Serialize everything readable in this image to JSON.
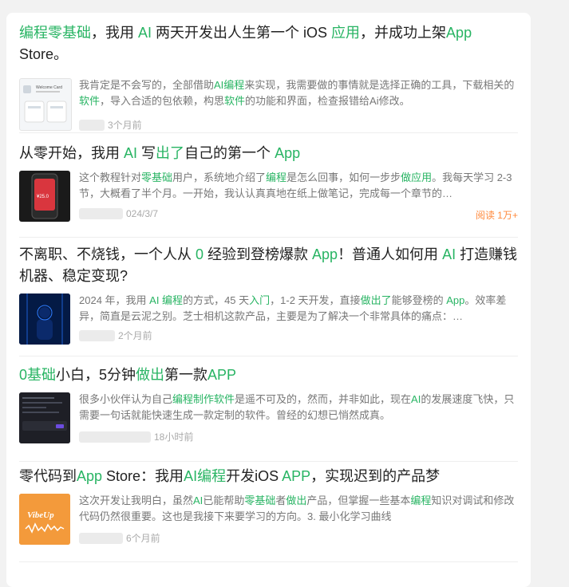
{
  "feed": {
    "items": [
      {
        "title": [
          {
            "t": "编程零基础",
            "hl": true
          },
          {
            "t": "，我用 ",
            "hl": false
          },
          {
            "t": "AI",
            "hl": true
          },
          {
            "t": " 两天开发出人生第一个 iOS ",
            "hl": false
          },
          {
            "t": "应用",
            "hl": true
          },
          {
            "t": "，并成功上架",
            "hl": false
          },
          {
            "t": "App",
            "hl": true
          },
          {
            "t": " Store。",
            "hl": false
          }
        ],
        "summary": [
          {
            "t": "我肯定是不会写的，全部借助",
            "hl": false
          },
          {
            "t": "AI编程",
            "hl": true
          },
          {
            "t": "来实现，我需要做的事情就是选择正确的工具，下载相关的",
            "hl": false
          },
          {
            "t": "软件",
            "hl": true
          },
          {
            "t": "，导入合适的包依赖，构思",
            "hl": false
          },
          {
            "t": "软件",
            "hl": true
          },
          {
            "t": "的功能和界面，检查报错给Ai修改。",
            "hl": false
          }
        ],
        "time": "3个月前",
        "thumb_icon": "app-screenshot-thumbnail",
        "thumb_caption": "Welcome Card"
      },
      {
        "title": [
          {
            "t": "从零开始，我用 ",
            "hl": false
          },
          {
            "t": "AI",
            "hl": true
          },
          {
            "t": " 写",
            "hl": false
          },
          {
            "t": "出了",
            "hl": true
          },
          {
            "t": "自己的第一个 ",
            "hl": false
          },
          {
            "t": "App",
            "hl": true
          }
        ],
        "summary": [
          {
            "t": "这个教程针对",
            "hl": false
          },
          {
            "t": "零基础",
            "hl": true
          },
          {
            "t": "用户，系统地介绍了",
            "hl": false
          },
          {
            "t": "编程",
            "hl": true
          },
          {
            "t": "是怎么回事，如何一步步",
            "hl": false
          },
          {
            "t": "做应用",
            "hl": true
          },
          {
            "t": "。我每天学习 2-3 节，大概看了半个月。一开始，我认认真真地在纸上做笔记，完成每一个章节的…",
            "hl": false
          }
        ],
        "time": "024/3/7",
        "reads": "阅读 1万+",
        "thumb_icon": "phone-thumbnail",
        "thumb_caption": "¥25.0"
      },
      {
        "title": [
          {
            "t": "不离职、不烧钱，一个人从 ",
            "hl": false
          },
          {
            "t": "0",
            "hl": true
          },
          {
            "t": " 经验到登榜爆款 ",
            "hl": false
          },
          {
            "t": "App",
            "hl": true
          },
          {
            "t": "！普通人如何用 ",
            "hl": false
          },
          {
            "t": "AI",
            "hl": true
          },
          {
            "t": " 打造赚钱机器、稳定变现?",
            "hl": false
          }
        ],
        "summary": [
          {
            "t": "2024 年，我用 ",
            "hl": false
          },
          {
            "t": "AI 编程",
            "hl": true
          },
          {
            "t": "的方式，45 天",
            "hl": false
          },
          {
            "t": "入门",
            "hl": true
          },
          {
            "t": "，1-2 天开发，直接",
            "hl": false
          },
          {
            "t": "做出了",
            "hl": true
          },
          {
            "t": "能够登榜的 ",
            "hl": false
          },
          {
            "t": "App",
            "hl": true
          },
          {
            "t": "。效率差异，简直是云泥之别。芝士相机这款产品，主要是为了解决一个非常具体的痛点：…",
            "hl": false
          }
        ],
        "time": "2个月前",
        "thumb_icon": "digital-figure-thumbnail"
      },
      {
        "title": [
          {
            "t": "0基础",
            "hl": true
          },
          {
            "t": "小白，5分钟",
            "hl": false
          },
          {
            "t": "做出",
            "hl": true
          },
          {
            "t": "第一款",
            "hl": false
          },
          {
            "t": "APP",
            "hl": true
          }
        ],
        "summary": [
          {
            "t": "很多小伙伴认为自己",
            "hl": false
          },
          {
            "t": "编程制作软件",
            "hl": true
          },
          {
            "t": "是遥不可及的，然而，并非如此，现在",
            "hl": false
          },
          {
            "t": "AI",
            "hl": true
          },
          {
            "t": "的发展速度飞快，只需要一句话就能快速生成一款定制的软件。曾经的幻想已悄然成真。",
            "hl": false
          }
        ],
        "time": "18小时前",
        "thumb_icon": "dark-editor-thumbnail"
      },
      {
        "title": [
          {
            "t": "零代码到",
            "hl": false
          },
          {
            "t": "App",
            "hl": true
          },
          {
            "t": " Store：我用",
            "hl": false
          },
          {
            "t": "AI编程",
            "hl": true
          },
          {
            "t": "开发iOS ",
            "hl": false
          },
          {
            "t": "APP",
            "hl": true
          },
          {
            "t": "，实现迟到的产品梦",
            "hl": false
          }
        ],
        "summary": [
          {
            "t": "这次开发让我明白，虽然",
            "hl": false
          },
          {
            "t": "AI",
            "hl": true
          },
          {
            "t": "已能帮助",
            "hl": false
          },
          {
            "t": "零基础",
            "hl": true
          },
          {
            "t": "者",
            "hl": false
          },
          {
            "t": "做出",
            "hl": true
          },
          {
            "t": "产品，但掌握一些基本",
            "hl": false
          },
          {
            "t": "编程",
            "hl": true
          },
          {
            "t": "知识对调试和修改代码仍然很重要。这也是我接下来要学习的方向。3. 最小化学习曲线",
            "hl": false
          }
        ],
        "time": "6个月前",
        "thumb_icon": "vibe-up-logo-thumbnail",
        "thumb_caption": "VibeUp"
      }
    ]
  }
}
